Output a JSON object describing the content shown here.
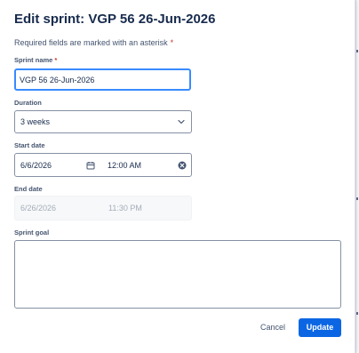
{
  "dialog": {
    "title": "Edit sprint: VGP 56 26-Jun-2026",
    "required_note": "Required fields are marked with an asterisk",
    "asterisk": "*"
  },
  "sprint_name": {
    "label": "Sprint name",
    "value": "VGP 56 26-Jun-2026"
  },
  "duration": {
    "label": "Duration",
    "value": "3 weeks",
    "icon": "chevron-down-icon"
  },
  "start_date": {
    "label": "Start date",
    "date": "6/6/2026",
    "time": "12:00 AM",
    "calendar_icon": "calendar-icon",
    "clear_icon": "clear-icon"
  },
  "end_date": {
    "label": "End date",
    "date": "6/26/2026",
    "time": "11:30 PM"
  },
  "sprint_goal": {
    "label": "Sprint goal",
    "value": ""
  },
  "actions": {
    "cancel": "Cancel",
    "update": "Update"
  },
  "colors": {
    "primary": "#0c66e4",
    "focus": "#388bff",
    "required": "#c9372c",
    "text": "#172b4d",
    "subtle_text": "#44546f",
    "border": "#8590a2",
    "disabled_text": "#a5adba"
  }
}
